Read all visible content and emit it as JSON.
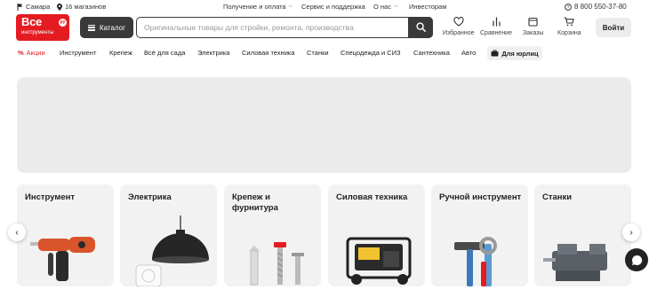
{
  "topbar": {
    "city": "Самара",
    "stores": "16 магазинов",
    "delivery": "Получение и оплата",
    "service": "Сервис и поддержка",
    "about": "О нас",
    "investors": "Инвесторам",
    "phone": "8 800 550-37-80"
  },
  "logo": {
    "line1": "Все",
    "line2": "инструменты",
    "badge": "ру"
  },
  "header": {
    "catalog_label": "Каталог",
    "search_placeholder": "Оригинальные товары для стройки, ремонта, производства",
    "favorites": "Избранное",
    "compare": "Сравнение",
    "orders": "Заказы",
    "cart": "Корзина",
    "login": "Войти"
  },
  "nav": {
    "promo": "Акции",
    "items": [
      "Инструмент",
      "Крепеж",
      "Всё для сада",
      "Электрика",
      "Силовая техника",
      "Станки",
      "Спецодежда и СИЗ",
      "Сантехника",
      "Авто"
    ],
    "business": "Для юрлиц"
  },
  "categories": [
    "Инструмент",
    "Электрика",
    "Крепеж и фурнитура",
    "Силовая техника",
    "Ручной инструмент",
    "Станки"
  ],
  "colors": {
    "brand_red": "#e41c22",
    "dark": "#3a3a3a",
    "card_bg": "#f2f2f2"
  }
}
